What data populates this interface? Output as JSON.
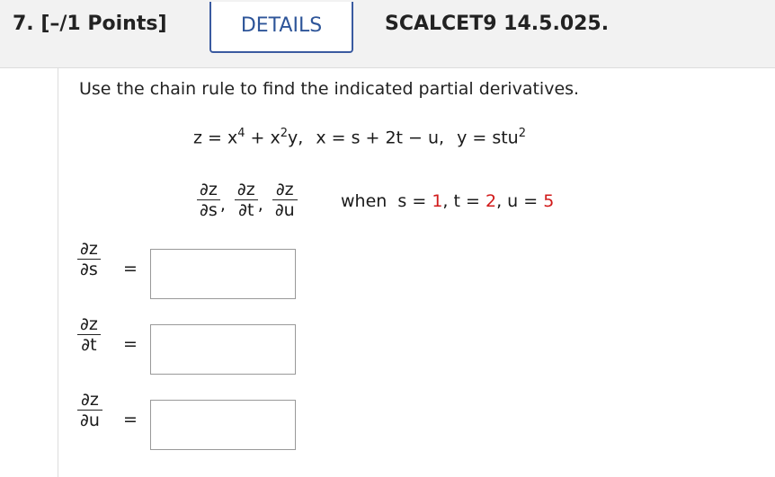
{
  "header": {
    "question_number": "7.",
    "points": "[–/1 Points]",
    "details_tab": "DETAILS",
    "problem_code": "SCALCET9 14.5.025."
  },
  "problem": {
    "instruction": "Use the chain rule to find the indicated partial derivatives.",
    "equation": {
      "z_def": "z = x",
      "z_exp1": "4",
      "z_plus": " + x",
      "z_exp2": "2",
      "z_tail": "y,",
      "x_def": "x = s + 2t − u,",
      "y_def": "y = stu",
      "y_exp": "2"
    },
    "partials": {
      "numerator": "∂z",
      "den_s": "∂s",
      "den_t": "∂t",
      "den_u": "∂u",
      "comma": ","
    },
    "condition": {
      "when": "when",
      "s_label": "s =",
      "s_value": "1",
      "t_label": "t =",
      "t_value": "2",
      "u_label": "u =",
      "u_value": "5",
      "sep": ","
    }
  },
  "answers": [
    {
      "numerator": "∂z",
      "denominator": "∂s",
      "equals": "=",
      "value": ""
    },
    {
      "numerator": "∂z",
      "denominator": "∂t",
      "equals": "=",
      "value": ""
    },
    {
      "numerator": "∂z",
      "denominator": "∂u",
      "equals": "=",
      "value": ""
    }
  ],
  "colors": {
    "accent": "#2e5599",
    "highlight_value": "#d11a1a"
  }
}
